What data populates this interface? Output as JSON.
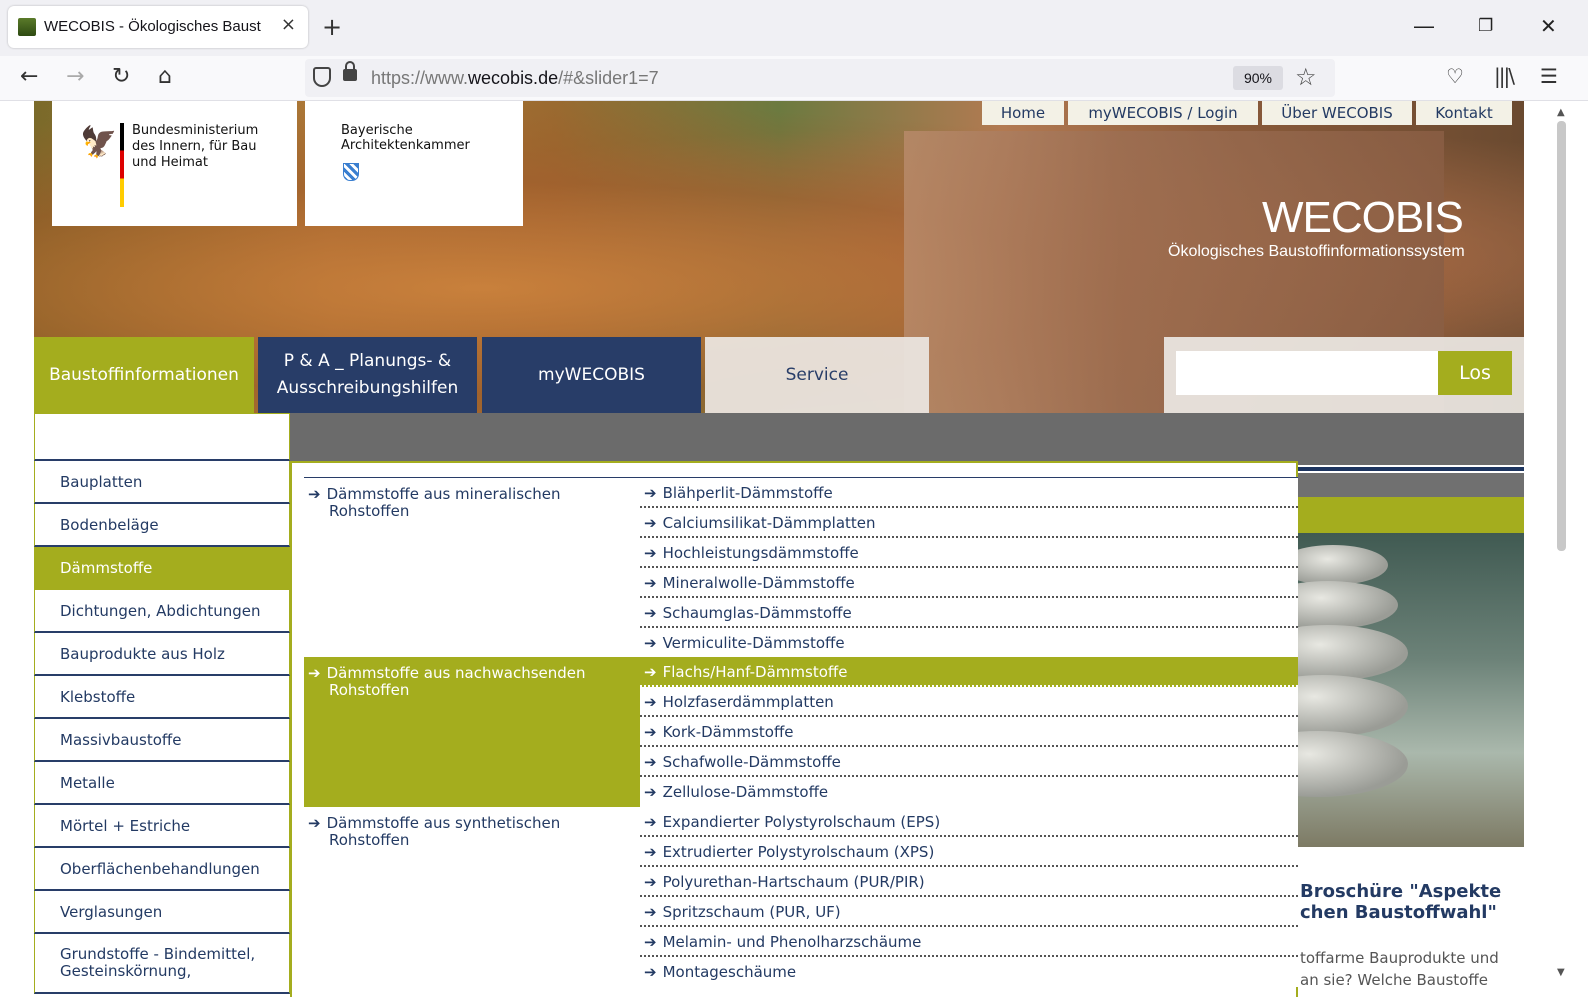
{
  "browser": {
    "tab_title": "WECOBIS - Ökologisches Baust",
    "tab_close": "×",
    "new_tab": "+",
    "url_prefix": "https://www.",
    "url_domain": "wecobis.de",
    "url_path": "/#&slider1=7",
    "zoom": "90%",
    "icons": [
      "back-arrow-icon",
      "forward-arrow-icon",
      "reload-icon",
      "home-icon",
      "shield-icon",
      "lock-icon",
      "bookmark-star-icon",
      "pocket-icon",
      "library-icon",
      "menu-icon"
    ]
  },
  "logos": {
    "bund": "Bundesministerium des Innern, für Bau und Heimat",
    "bayern_line1": "Bayerische",
    "bayern_line2": "Architektenkammer"
  },
  "topnav": [
    "Home",
    "myWECOBIS / Login",
    "Über WECOBIS",
    "Kontakt"
  ],
  "brand": {
    "name_light": "WECO",
    "name_bold": "",
    "name_end": "BIS",
    "subtitle": "Ökologisches Baustoffinformationssystem"
  },
  "mainnav": {
    "baustoff": "Baustoffinformationen",
    "pa_line1": "P & A _ Planungs- &",
    "pa_line2": "Ausschreibungshilfen",
    "my": "myWECOBIS",
    "service": "Service"
  },
  "search": {
    "button": "Los",
    "value": ""
  },
  "sidebar": {
    "items": [
      "Bauplatten",
      "Bodenbeläge",
      "Dämmstoffe",
      "Dichtungen, Abdichtungen",
      "Bauprodukte aus Holz",
      "Klebstoffe",
      "Massivbaustoffe",
      "Metalle",
      "Mörtel + Estriche",
      "Oberflächenbehandlungen",
      "Verglasungen"
    ],
    "last_line1": "Grundstoffe - Bindemittel,",
    "last_line2": "Gesteinskörnung,"
  },
  "megamenu": {
    "arrow": "➔",
    "sections": [
      {
        "cat_line1": "Dämmstoffe aus mineralischen",
        "cat_line2": "Rohstoffen",
        "links": [
          "Blähperlit-Dämmstoffe",
          "Calciumsilikat-Dämmplatten",
          "Hochleistungsdämmstoffe",
          "Mineralwolle-Dämmstoffe",
          "Schaumglas-Dämmstoffe",
          "Vermiculite-Dämmstoffe"
        ]
      },
      {
        "cat_line1": "Dämmstoffe aus nachwachsenden",
        "cat_line2": "Rohstoffen",
        "links": [
          "Flachs/Hanf-Dämmstoffe",
          "Holzfaserdämmplatten",
          "Kork-Dämmstoffe",
          "Schafwolle-Dämmstoffe",
          "Zellulose-Dämmstoffe"
        ]
      },
      {
        "cat_line1": "Dämmstoffe aus synthetischen",
        "cat_line2": "Rohstoffen",
        "links": [
          "Expandierter Polystyrolschaum (EPS)",
          "Extrudierter Polystyrolschaum (XPS)",
          "Polyurethan-Hartschaum (PUR/PIR)",
          "Spritzschaum (PUR, UF)",
          "Melamin- und Phenolharzschäume",
          "Montageschäume"
        ]
      }
    ]
  },
  "rightpanel": {
    "title_line1": "Broschüre \"Aspekte",
    "title_line2": "chen Baustoffwahl\"",
    "text_line1": "toffarme Bauprodukte und",
    "text_line2": "an sie? Welche Baustoffe"
  },
  "colors": {
    "accent_green": "#a4ad1e",
    "navy": "#283d68",
    "link_blue": "#233a63"
  }
}
